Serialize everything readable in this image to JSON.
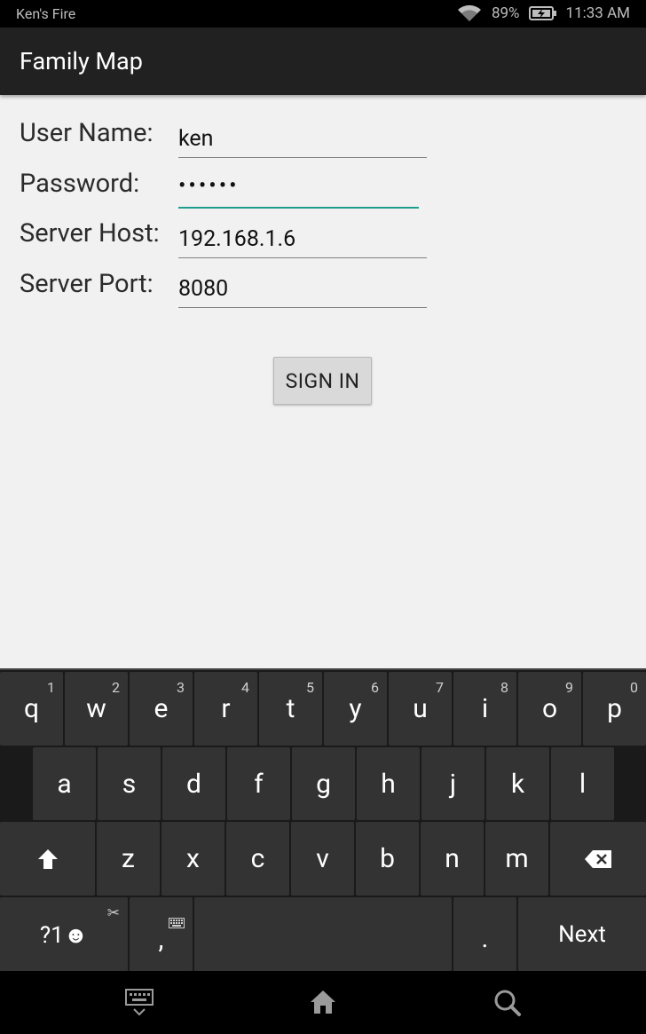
{
  "status_bar": {
    "device_name": "Ken's Fire",
    "battery": "89%",
    "time": "11:33 AM"
  },
  "app": {
    "title": "Family Map"
  },
  "form": {
    "username_label": "User Name:",
    "username_value": "ken",
    "password_label": "Password:",
    "password_value": "••••••",
    "host_label": "Server Host:",
    "host_value": "192.168.1.6",
    "port_label": "Server Port:",
    "port_value": "8080",
    "sign_in_label": "SIGN IN"
  },
  "keyboard": {
    "row1": [
      {
        "k": "q",
        "h": "1"
      },
      {
        "k": "w",
        "h": "2"
      },
      {
        "k": "e",
        "h": "3"
      },
      {
        "k": "r",
        "h": "4"
      },
      {
        "k": "t",
        "h": "5"
      },
      {
        "k": "y",
        "h": "6"
      },
      {
        "k": "u",
        "h": "7"
      },
      {
        "k": "i",
        "h": "8"
      },
      {
        "k": "o",
        "h": "9"
      },
      {
        "k": "p",
        "h": "0"
      }
    ],
    "row2": [
      "a",
      "s",
      "d",
      "f",
      "g",
      "h",
      "j",
      "k",
      "l"
    ],
    "row3": [
      "z",
      "x",
      "c",
      "v",
      "b",
      "n",
      "m"
    ],
    "symbols_label": "?1☻",
    "comma_label": ",",
    "period_label": ".",
    "next_label": "Next"
  },
  "colors": {
    "accent": "#1f9e8e",
    "actionbar": "#212121",
    "background": "#f1f1f1"
  }
}
